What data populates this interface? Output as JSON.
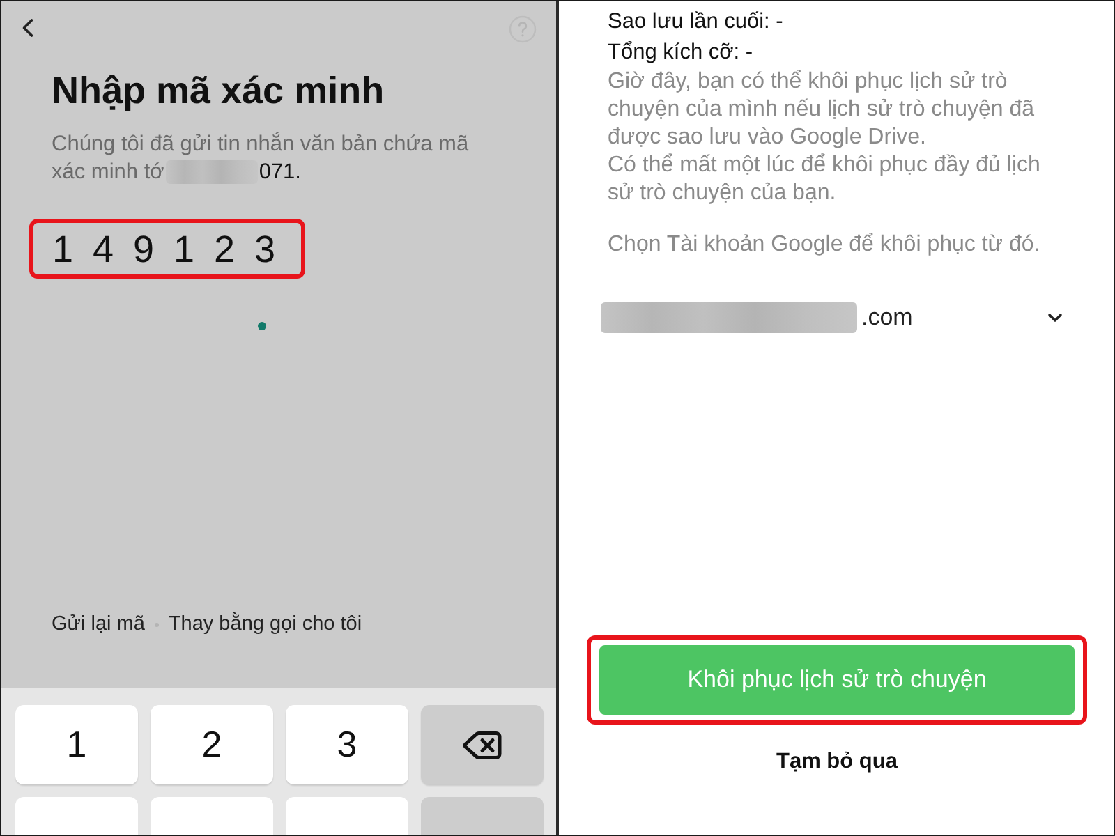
{
  "verification_screen": {
    "title": "Nhập mã xác minh",
    "message": "Chúng tôi đã gửi tin nhắn văn bản chứa mã xác minh tớ",
    "phone_number_end": "071.",
    "code": {
      "digits": [
        "1",
        "4",
        "9",
        "1",
        "2",
        "3"
      ],
      "highlighted": true
    },
    "links": [
      "Gửi lại mã",
      "Thay bằng gọi cho tôi"
    ]
  },
  "keypad": {
    "keys": [
      {
        "kind": "digit",
        "label": "1"
      },
      {
        "kind": "digit",
        "label": "2"
      },
      {
        "kind": "digit",
        "label": "3"
      },
      {
        "kind": "backspace"
      },
      {
        "kind": "digit"
      },
      {
        "kind": "digit"
      },
      {
        "kind": "digit"
      },
      {
        "kind": "action"
      }
    ]
  },
  "restore_screen": {
    "last_backup": "Sao lưu lần cuối: -",
    "total_size": "Tổng kích cỡ: -",
    "description": [
      "Giờ đây, bạn có thể khôi phục lịch sử trò chuyện của mình nếu lịch sử trò chuyện đã được sao lưu vào Google Drive.",
      "Có thể mất một lúc để khôi phục đầy đủ lịch sử trò chuyện của bạn."
    ],
    "prompt": "Chọn Tài khoản Google để khôi phục từ đó.",
    "account_suffix": ".com",
    "restore_button": {
      "label": "Khôi phục lịch sử trò chuyện",
      "highlighted": true
    },
    "skip_link": "Tạm bỏ qua"
  }
}
